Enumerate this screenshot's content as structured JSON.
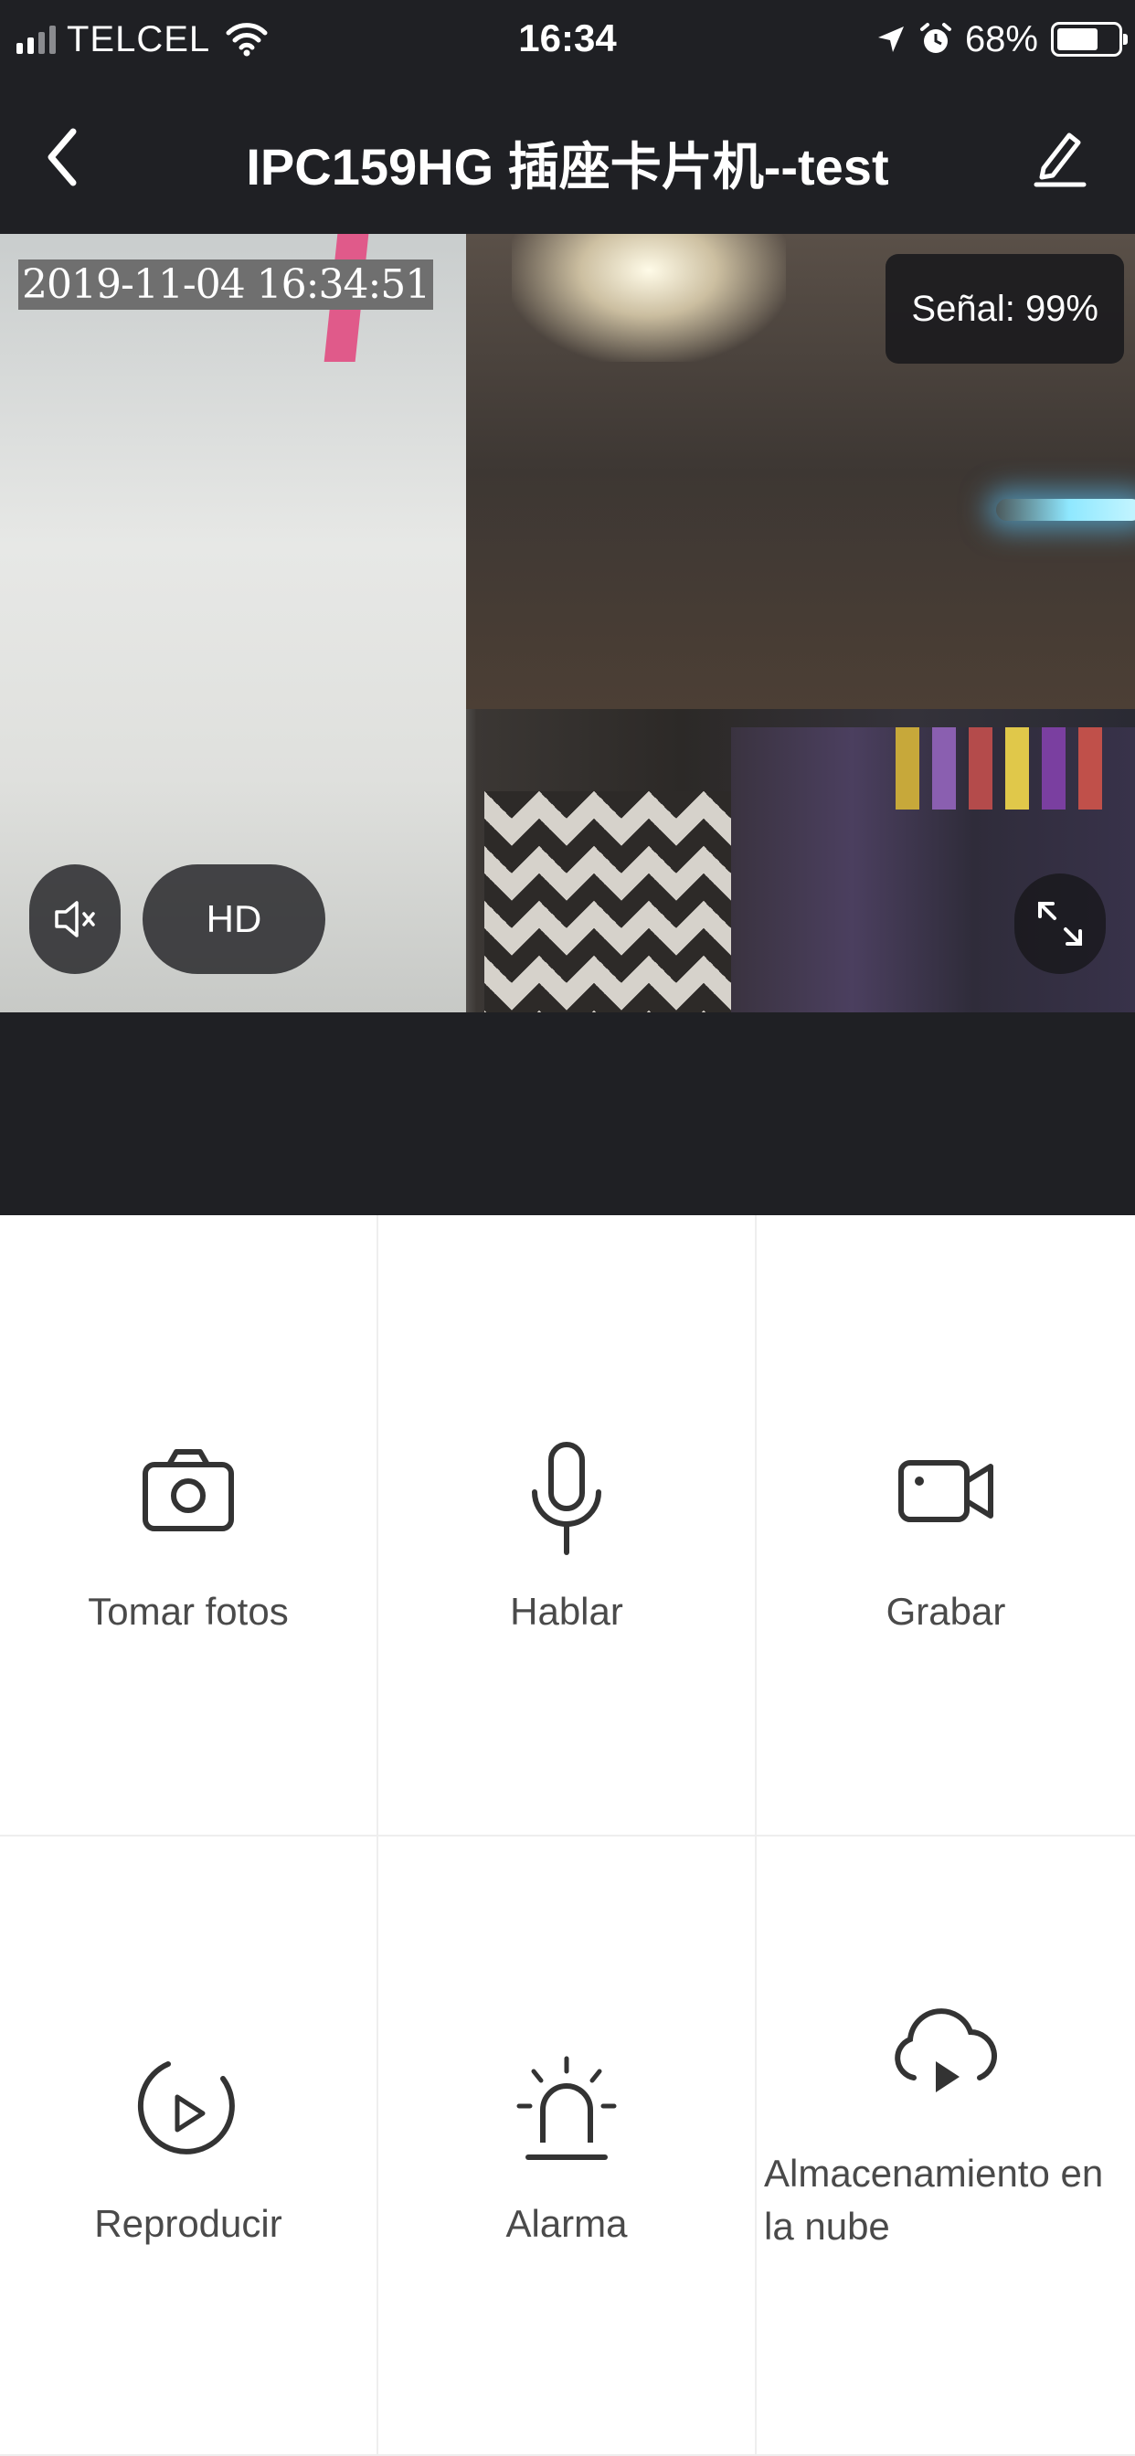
{
  "status_bar": {
    "carrier": "TELCEL",
    "time": "16:34",
    "battery_percent": "68%",
    "battery_level": 0.68,
    "icons": [
      "signal-icon",
      "wifi-icon",
      "location-arrow-icon",
      "alarm-clock-icon",
      "battery-icon"
    ]
  },
  "nav": {
    "title": "IPC159HG 插座卡片机--test",
    "back_icon": "chevron-left-icon",
    "edit_icon": "pencil-icon"
  },
  "video": {
    "timestamp": "2019-11-04 16:34:51",
    "signal_label": "Señal: 99%",
    "quality_label": "HD",
    "mute_icon": "speaker-muted-icon",
    "fullscreen_icon": "expand-icon"
  },
  "controls": [
    {
      "label": "Tomar fotos",
      "icon": "camera-icon"
    },
    {
      "label": "Hablar",
      "icon": "microphone-icon"
    },
    {
      "label": "Grabar",
      "icon": "video-camera-icon"
    },
    {
      "label": "Reproducir",
      "icon": "replay-icon"
    },
    {
      "label": "Alarma",
      "icon": "alarm-siren-icon"
    },
    {
      "label": "Almacenamiento en la nube",
      "icon": "cloud-play-icon"
    }
  ],
  "colors": {
    "header_bg": "#1f2024",
    "text_label": "#4a4a4a",
    "icon_stroke": "#333333",
    "divider": "#eeeeee"
  }
}
